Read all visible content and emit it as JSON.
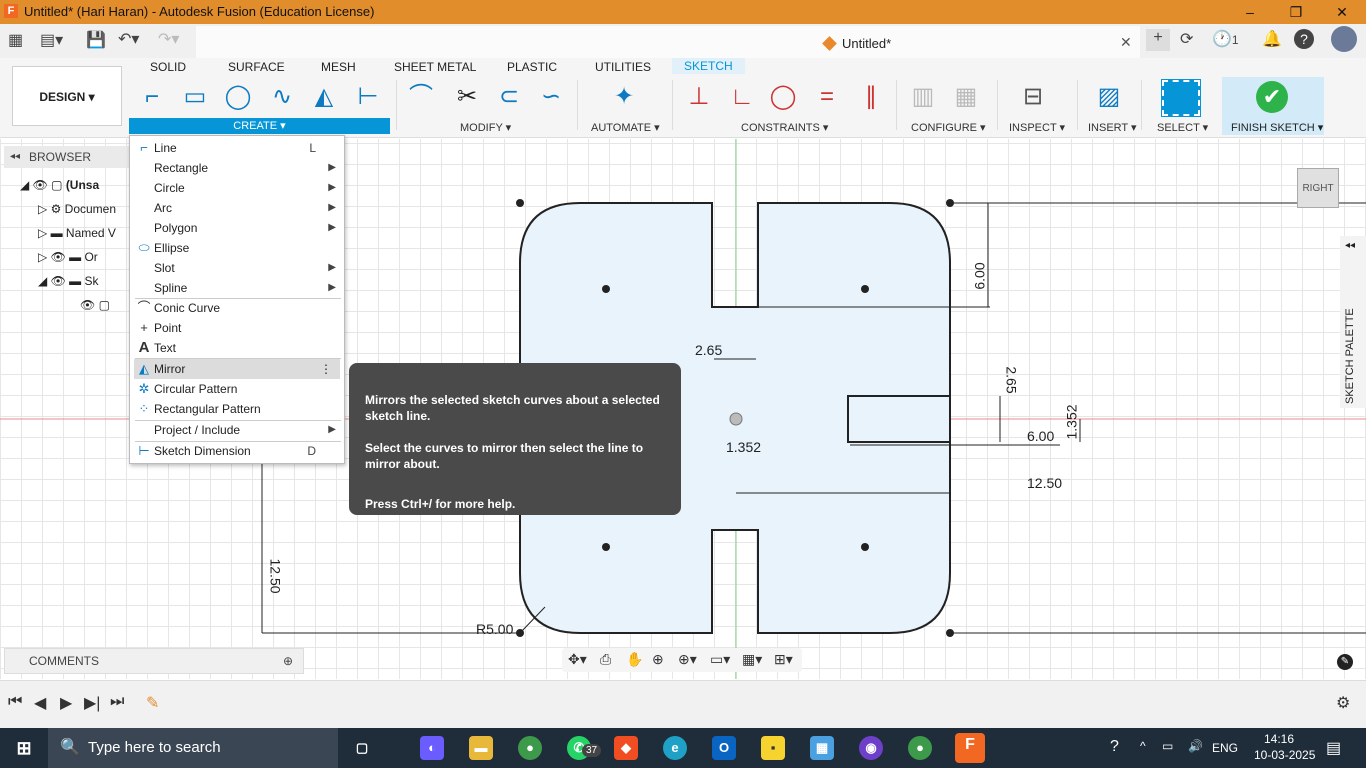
{
  "window": {
    "title": "Untitled* (Hari Haran) - Autodesk Fusion (Education License)",
    "app_icon": "F"
  },
  "doc_tab": {
    "name": "Untitled*"
  },
  "quick_access": {
    "job_count": "1"
  },
  "workspace": {
    "label": "DESIGN ▾"
  },
  "ribbon_tabs": [
    "SOLID",
    "SURFACE",
    "MESH",
    "SHEET METAL",
    "PLASTIC",
    "UTILITIES",
    "SKETCH"
  ],
  "ribbon_groups": {
    "create": "CREATE ▾",
    "modify": "MODIFY ▾",
    "automate": "AUTOMATE ▾",
    "constraints": "CONSTRAINTS ▾",
    "configure": "CONFIGURE ▾",
    "inspect": "INSPECT ▾",
    "insert": "INSERT ▾",
    "select": "SELECT ▾",
    "finish": "FINISH SKETCH ▾"
  },
  "browser": {
    "title": "BROWSER",
    "items": [
      "(Unsa",
      "Documen",
      "Named V",
      "Or",
      "Sk"
    ]
  },
  "comments": {
    "label": "COMMENTS"
  },
  "create_menu": {
    "items": [
      {
        "label": "Line",
        "shortcut": "L",
        "icon": "line-icon"
      },
      {
        "label": "Rectangle",
        "submenu": true
      },
      {
        "label": "Circle",
        "submenu": true
      },
      {
        "label": "Arc",
        "submenu": true
      },
      {
        "label": "Polygon",
        "submenu": true
      },
      {
        "label": "Ellipse",
        "icon": "ellipse-icon"
      },
      {
        "label": "Slot",
        "submenu": true
      },
      {
        "label": "Spline",
        "submenu": true
      },
      {
        "label": "Conic Curve",
        "icon": "conic-icon"
      },
      {
        "label": "Point",
        "icon": "point-icon"
      },
      {
        "label": "Text",
        "icon": "text-icon"
      },
      {
        "label": "Mirror",
        "icon": "mirror-icon",
        "highlighted": true
      },
      {
        "label": "Circular Pattern",
        "icon": "circular-pattern-icon"
      },
      {
        "label": "Rectangular Pattern",
        "icon": "rectangular-pattern-icon"
      },
      {
        "label": "Project / Include",
        "submenu": true
      },
      {
        "label": "Sketch Dimension",
        "shortcut": "D",
        "icon": "dimension-icon"
      }
    ]
  },
  "tooltip": {
    "line1": "Mirrors the selected sketch curves about a selected sketch line.",
    "line2": "Select the curves to mirror then select the line to mirror about.",
    "line3": "Press Ctrl+/ for more help."
  },
  "dimensions": {
    "d1": "2.65",
    "d2": "1.352",
    "d3": "6.00",
    "d4": "2.65",
    "d5": "1.352",
    "d6": "6.00",
    "d7": "12.50",
    "d8": "12.50",
    "d9": "R5.00"
  },
  "viewcube": {
    "label": "RIGHT"
  },
  "sketch_palette": {
    "label": "SKETCH PALETTE"
  },
  "taskbar": {
    "search_placeholder": "Type here to search",
    "whatsapp_badge": "37",
    "language": "ENG",
    "time": "14:16",
    "date": "10-03-2025"
  }
}
